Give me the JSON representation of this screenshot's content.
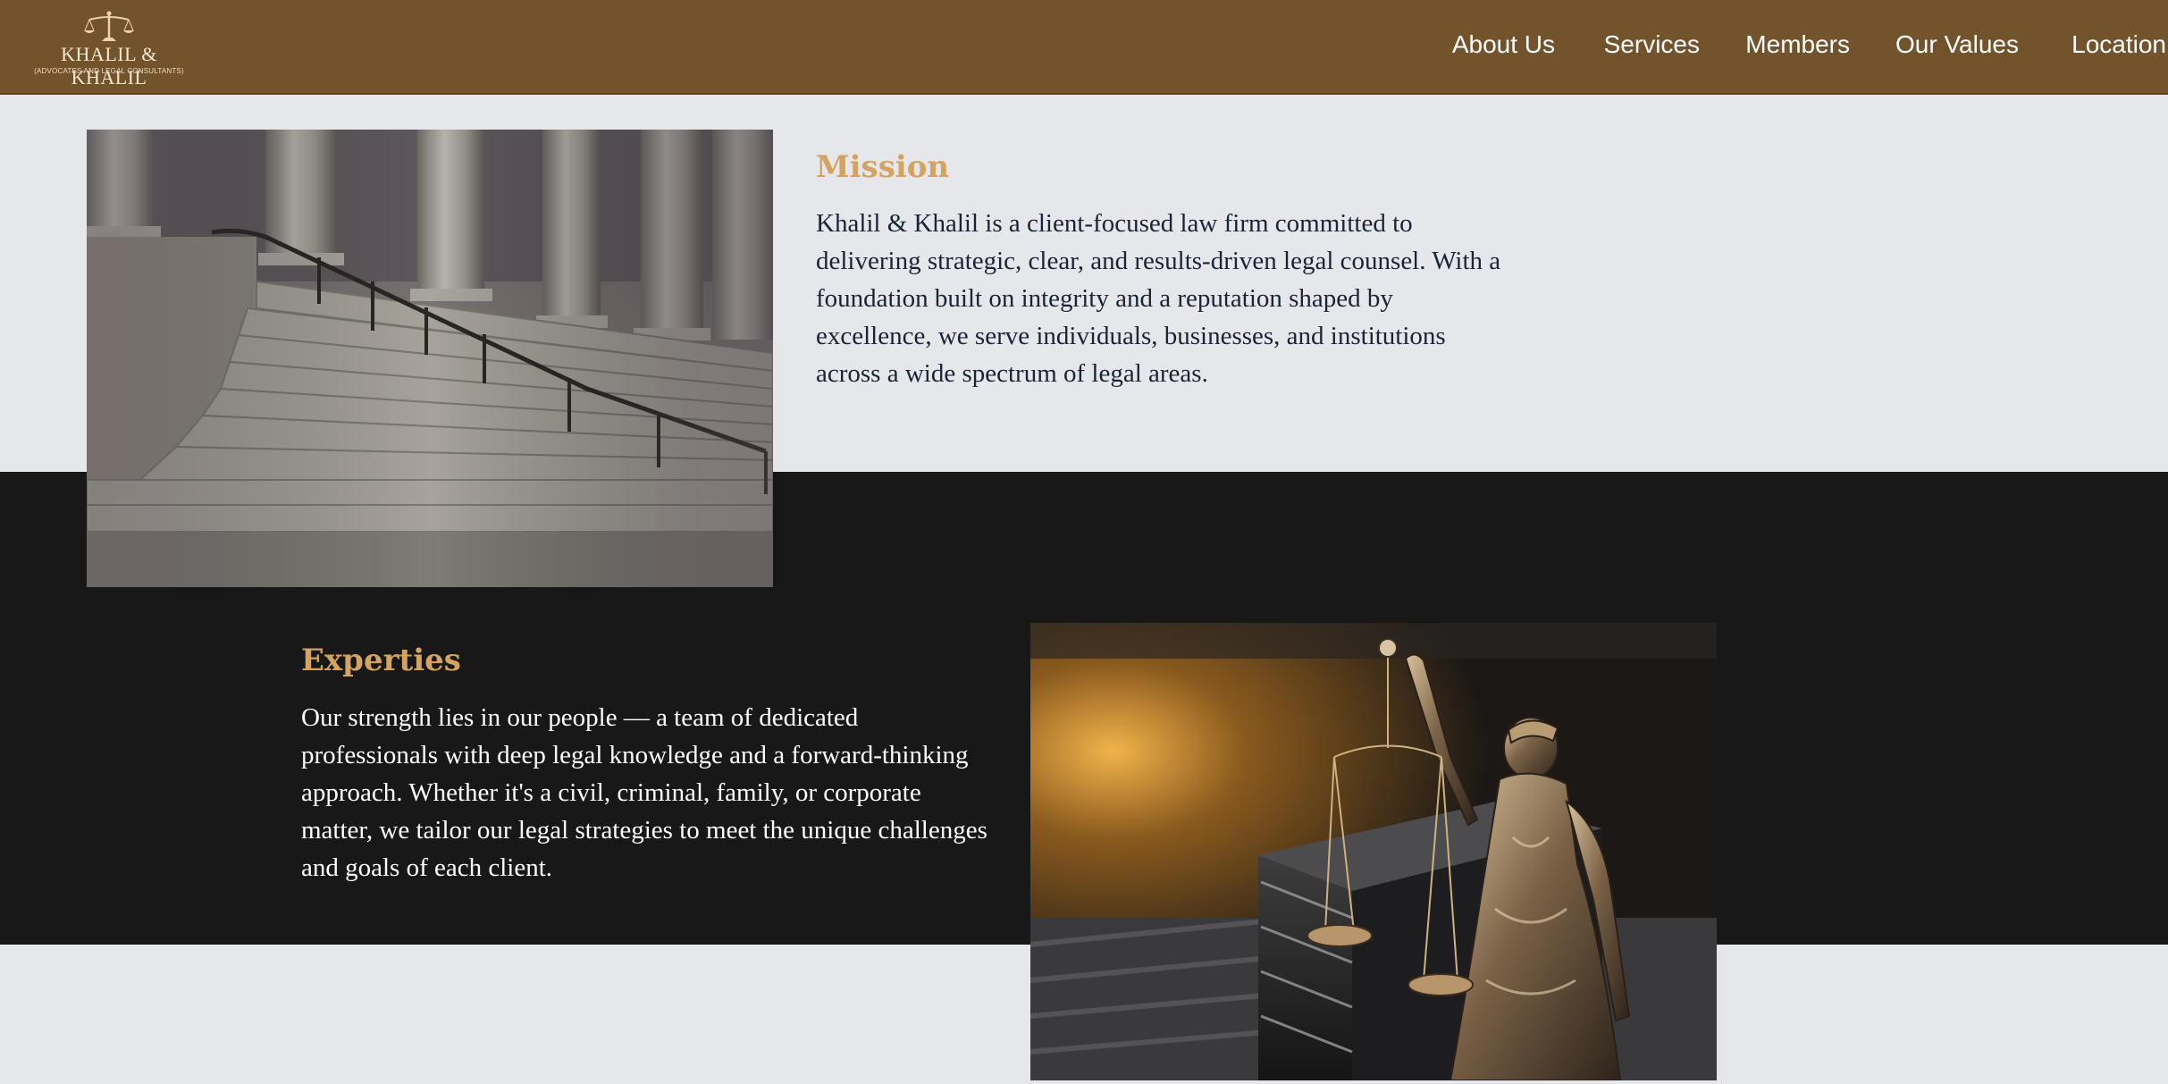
{
  "brand": {
    "name": "KHALIL & KHALIL",
    "tagline": "(ADVOCATES AND LEGAL CONSULTANTS)",
    "colors": {
      "header": "#73532c",
      "accent": "#d3a35f",
      "dark": "#181818",
      "light": "#e6e7ea"
    }
  },
  "nav": {
    "items": [
      {
        "label": "About Us"
      },
      {
        "label": "Services"
      },
      {
        "label": "Members"
      },
      {
        "label": "Our Values"
      },
      {
        "label": "Location"
      }
    ]
  },
  "mission": {
    "title": "Mission",
    "text": "Khalil & Khalil is a client-focused law firm committed to delivering strategic, clear, and results-driven legal counsel. With a foundation built on integrity and a reputation shaped by excellence, we serve individuals, businesses, and institutions across a wide spectrum of legal areas.",
    "image_icon": "courthouse-steps-photo"
  },
  "expertise": {
    "title": "Experties",
    "text": "Our strength lies in our people — a team of dedicated professionals with deep legal knowledge and a forward-thinking approach. Whether it's a civil, criminal, family, or corporate matter, we tailor our legal strategies to meet the unique challenges and goals of each client.",
    "image_icon": "lady-justice-statue-photo"
  }
}
